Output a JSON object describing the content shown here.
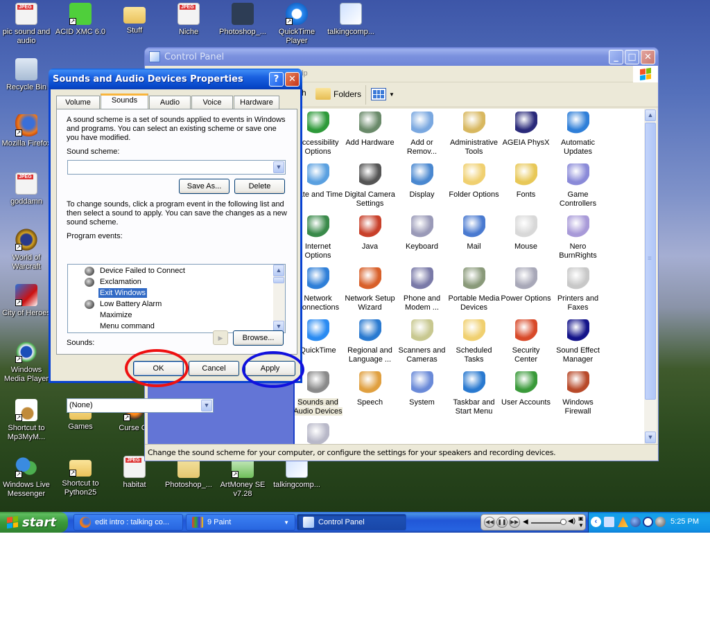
{
  "desktop": {
    "icons": [
      {
        "label": "pic sound and audio",
        "icon": "jpeg-file-icon",
        "shortcut": false
      },
      {
        "label": "ACID XMC 6.0",
        "icon": "headphones-app-icon",
        "shortcut": true
      },
      {
        "label": "Stuff",
        "icon": "folder-icon",
        "shortcut": false
      },
      {
        "label": "Niche",
        "icon": "jpeg-file-icon",
        "shortcut": false
      },
      {
        "label": "Photoshop_...",
        "icon": "photoshop-app-icon",
        "shortcut": false
      },
      {
        "label": "QuickTime Player",
        "icon": "quicktime-icon",
        "shortcut": true
      },
      {
        "label": "talkingcomp...",
        "icon": "paint-document-icon",
        "shortcut": false
      },
      {
        "label": "Recycle Bin",
        "icon": "recycle-bin-icon",
        "shortcut": false
      },
      {
        "label": "Mozilla Firefox",
        "icon": "firefox-icon",
        "shortcut": true
      },
      {
        "label": "goddamn",
        "icon": "jpeg-file-icon",
        "shortcut": false
      },
      {
        "label": "World of Warcraft",
        "icon": "wow-icon",
        "shortcut": true
      },
      {
        "label": "City of Heroes",
        "icon": "city-of-heroes-icon",
        "shortcut": true
      },
      {
        "label": "Windows Media Player",
        "icon": "media-player-icon",
        "shortcut": true
      },
      {
        "label": "Shortcut to Mp3MyM...",
        "icon": "mp3mym-icon",
        "shortcut": true
      },
      {
        "label": "Windows Live Messenger",
        "icon": "messenger-icon",
        "shortcut": true
      },
      {
        "label": "Games",
        "icon": "folder-icon",
        "shortcut": false
      },
      {
        "label": "Curse Cli",
        "icon": "curse-client-icon",
        "shortcut": true
      },
      {
        "label": "Shortcut to Python25",
        "icon": "folder-icon",
        "shortcut": true
      },
      {
        "label": "habitat",
        "icon": "jpeg-file-icon",
        "shortcut": false
      },
      {
        "label": "Photoshop_...",
        "icon": "zip-archive-icon",
        "shortcut": false
      },
      {
        "label": "ArtMoney SE v7.28",
        "icon": "artmoney-icon",
        "shortcut": true
      },
      {
        "label": "talkingcomp...",
        "icon": "paint-document-icon",
        "shortcut": false
      }
    ]
  },
  "control_panel": {
    "title": "Control Panel",
    "menu_partial": "elp",
    "toolbar": {
      "search_partial": "h",
      "folders": "Folders"
    },
    "items": [
      {
        "label": "Accessibility Options",
        "icon": "accessibility-icon",
        "color": "#2e9a3a"
      },
      {
        "label": "Add Hardware",
        "icon": "add-hardware-icon",
        "color": "#6a8a6a"
      },
      {
        "label": "Add or Remov...",
        "icon": "add-remove-programs-icon",
        "color": "#7aa8e0"
      },
      {
        "label": "Administrative Tools",
        "icon": "admin-tools-icon",
        "color": "#d8b860"
      },
      {
        "label": "AGEIA PhysX",
        "icon": "ageia-physx-icon",
        "color": "#2a2a7a"
      },
      {
        "label": "Automatic Updates",
        "icon": "automatic-updates-icon",
        "color": "#2f7fd8"
      },
      {
        "label": "Date and Time",
        "icon": "date-time-icon",
        "color": "#5aa0e0"
      },
      {
        "label": "Digital Camera Settings",
        "icon": "camera-icon",
        "color": "#555555"
      },
      {
        "label": "Display",
        "icon": "display-icon",
        "color": "#4a88d0"
      },
      {
        "label": "Folder Options",
        "icon": "folder-options-icon",
        "color": "#f0d070"
      },
      {
        "label": "Fonts",
        "icon": "fonts-icon",
        "color": "#e8c858"
      },
      {
        "label": "Game Controllers",
        "icon": "game-controller-icon",
        "color": "#8a8ad8"
      },
      {
        "label": "Internet Options",
        "icon": "internet-options-icon",
        "color": "#3a8a4a"
      },
      {
        "label": "Java",
        "icon": "java-icon",
        "color": "#c8402a"
      },
      {
        "label": "Keyboard",
        "icon": "keyboard-icon",
        "color": "#9a9ab8"
      },
      {
        "label": "Mail",
        "icon": "mail-icon",
        "color": "#4a7ad0"
      },
      {
        "label": "Mouse",
        "icon": "mouse-icon",
        "color": "#d8d8d8"
      },
      {
        "label": "Nero BurnRights",
        "icon": "nero-icon",
        "color": "#a89ad8"
      },
      {
        "label": "Network Connections",
        "icon": "network-connections-icon",
        "color": "#2f7fd8"
      },
      {
        "label": "Network Setup Wizard",
        "icon": "network-wizard-icon",
        "color": "#d8602a"
      },
      {
        "label": "Phone and Modem ...",
        "icon": "phone-modem-icon",
        "color": "#7a7aa8"
      },
      {
        "label": "Portable Media Devices",
        "icon": "portable-media-icon",
        "color": "#8a9a7a"
      },
      {
        "label": "Power Options",
        "icon": "power-options-icon",
        "color": "#a8a8b8"
      },
      {
        "label": "Printers and Faxes",
        "icon": "printer-icon",
        "color": "#c8c8c8"
      },
      {
        "label": "QuickTime",
        "icon": "quicktime-icon",
        "color": "#2a8bf2"
      },
      {
        "label": "Regional and Language ...",
        "icon": "globe-icon",
        "color": "#2a7ad0"
      },
      {
        "label": "Scanners and Cameras",
        "icon": "scanner-icon",
        "color": "#c8c890"
      },
      {
        "label": "Scheduled Tasks",
        "icon": "scheduled-tasks-icon",
        "color": "#f0d070"
      },
      {
        "label": "Security Center",
        "icon": "security-shield-icon",
        "color": "#d84a2a"
      },
      {
        "label": "Sound Effect Manager",
        "icon": "sound-effect-icon",
        "color": "#14148a"
      },
      {
        "label": "Sounds and Audio Devices",
        "icon": "speaker-icon",
        "color": "#8a8a8a",
        "selected": true
      },
      {
        "label": "Speech",
        "icon": "speech-icon",
        "color": "#e0a040"
      },
      {
        "label": "System",
        "icon": "system-icon",
        "color": "#6a8ad8"
      },
      {
        "label": "Taskbar and Start Menu",
        "icon": "taskbar-icon",
        "color": "#2a7ad0"
      },
      {
        "label": "User Accounts",
        "icon": "user-accounts-icon",
        "color": "#3a9a3a"
      },
      {
        "label": "Windows Firewall",
        "icon": "firewall-icon",
        "color": "#b84a2a"
      },
      {
        "label": "",
        "icon": "wireless-device-icon",
        "color": "#b8b8c8"
      }
    ],
    "status": "Change the sound scheme for your computer, or configure the settings for your speakers and recording devices."
  },
  "dialog": {
    "title": "Sounds and Audio Devices Properties",
    "tabs": [
      {
        "label": "Volume",
        "active": false
      },
      {
        "label": "Sounds",
        "active": true
      },
      {
        "label": "Audio",
        "active": false
      },
      {
        "label": "Voice",
        "active": false
      },
      {
        "label": "Hardware",
        "active": false
      }
    ],
    "intro": "A sound scheme is a set of sounds applied to events in Windows and programs. You can select an existing scheme or save one you have modified.",
    "scheme_label": "Sound scheme:",
    "scheme_value": "",
    "save_as": "Save As...",
    "delete": "Delete",
    "instructions": "To change sounds, click a program event in the following list and then select a sound to apply. You can save the changes as a new sound scheme.",
    "events_label": "Program events:",
    "events": [
      {
        "label": "Device Failed to Connect",
        "has_sound": true,
        "selected": false
      },
      {
        "label": "Exclamation",
        "has_sound": true,
        "selected": false
      },
      {
        "label": "Exit Windows",
        "has_sound": false,
        "selected": true
      },
      {
        "label": "Low Battery Alarm",
        "has_sound": true,
        "selected": false
      },
      {
        "label": "Maximize",
        "has_sound": false,
        "selected": false
      },
      {
        "label": "Menu command",
        "has_sound": false,
        "selected": false
      }
    ],
    "sounds_label": "Sounds:",
    "sound_value": "(None)",
    "browse": "Browse...",
    "ok": "OK",
    "cancel": "Cancel",
    "apply": "Apply",
    "annotations": {
      "ok_circle_color": "#ee1111",
      "apply_circle_color": "#1111dd"
    }
  },
  "taskbar": {
    "start": "start",
    "tasks": [
      {
        "label": "edit intro : talking co...",
        "icon": "firefox-icon",
        "active": false
      },
      {
        "label": "9 Paint",
        "icon": "paint-icon",
        "active": false,
        "group_count": "9"
      },
      {
        "label": "Control Panel",
        "icon": "control-panel-icon",
        "active": true
      }
    ],
    "clock": "5:25 PM"
  }
}
